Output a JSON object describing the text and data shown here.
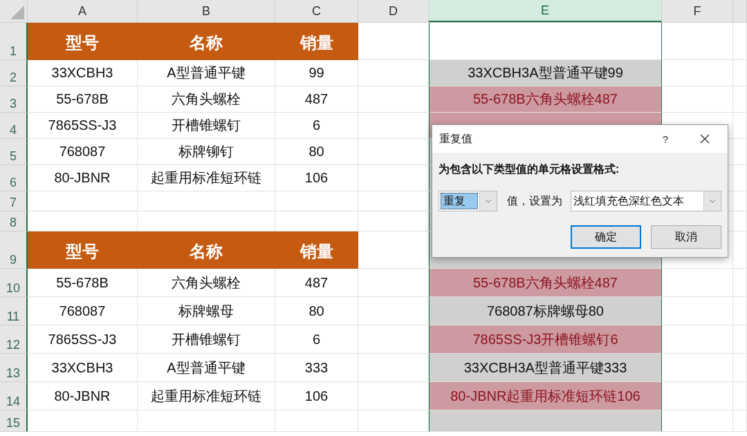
{
  "column_headers": [
    {
      "label": "A",
      "selected": false
    },
    {
      "label": "B",
      "selected": false
    },
    {
      "label": "C",
      "selected": false
    },
    {
      "label": "D",
      "selected": false
    },
    {
      "label": "E",
      "selected": true
    },
    {
      "label": "F",
      "selected": false
    }
  ],
  "rows": [
    {
      "number": "1",
      "kind": "header",
      "cells": [
        "型号",
        "名称",
        "销量"
      ]
    },
    {
      "number": "2",
      "kind": "data",
      "cells": [
        "33XCBH3",
        "A型普通平键",
        "99"
      ],
      "e": {
        "text": "33XCBH3A型普通平键99",
        "duplicate": false
      }
    },
    {
      "number": "3",
      "kind": "data",
      "cells": [
        "55-678B",
        "六角头螺栓",
        "487"
      ],
      "e": {
        "text": "55-678B六角头螺栓487",
        "duplicate": true
      }
    },
    {
      "number": "4",
      "kind": "data",
      "cells": [
        "7865SS-J3",
        "开槽锥螺钉",
        "6"
      ],
      "e": {
        "duplicate": true
      }
    },
    {
      "number": "5",
      "kind": "data",
      "cells": [
        "768087",
        "标牌铆钉",
        "80"
      ]
    },
    {
      "number": "6",
      "kind": "data",
      "cells": [
        "80-JBNR",
        "起重用标准短环链",
        "106"
      ]
    },
    {
      "number": "7",
      "kind": "blank"
    },
    {
      "number": "8",
      "kind": "blank"
    },
    {
      "number": "9",
      "kind": "header",
      "cells": [
        "型号",
        "名称",
        "销量"
      ]
    },
    {
      "number": "10",
      "kind": "data",
      "cells": [
        "55-678B",
        "六角头螺栓",
        "487"
      ],
      "e": {
        "text": "55-678B六角头螺栓487",
        "duplicate": true
      }
    },
    {
      "number": "11",
      "kind": "data",
      "cells": [
        "768087",
        "标牌螺母",
        "80"
      ],
      "e": {
        "text": "768087标牌螺母80",
        "duplicate": false
      }
    },
    {
      "number": "12",
      "kind": "data",
      "cells": [
        "7865SS-J3",
        "开槽锥螺钉",
        "6"
      ],
      "e": {
        "text": "7865SS-J3开槽锥螺钉6",
        "duplicate": true
      }
    },
    {
      "number": "13",
      "kind": "data",
      "cells": [
        "33XCBH3",
        "A型普通平键",
        "333"
      ],
      "e": {
        "text": "33XCBH3A型普通平键333",
        "duplicate": false
      }
    },
    {
      "number": "14",
      "kind": "data",
      "cells": [
        "80-JBNR",
        "起重用标准短环链",
        "106"
      ],
      "e": {
        "text": "80-JBNR起重用标准短环链106",
        "duplicate": true
      }
    },
    {
      "number": "15",
      "kind": "blank"
    }
  ],
  "dialog": {
    "title": "重复值",
    "help": "?",
    "prompt": "为包含以下类型值的单元格设置格式:",
    "type_dropdown": {
      "value": "重复"
    },
    "middle_label": "值，设置为",
    "format_dropdown": {
      "value": "浅红填充色深红色文本"
    },
    "buttons": [
      {
        "label": "确定",
        "default": true
      },
      {
        "label": "取消",
        "default": false
      }
    ]
  }
}
